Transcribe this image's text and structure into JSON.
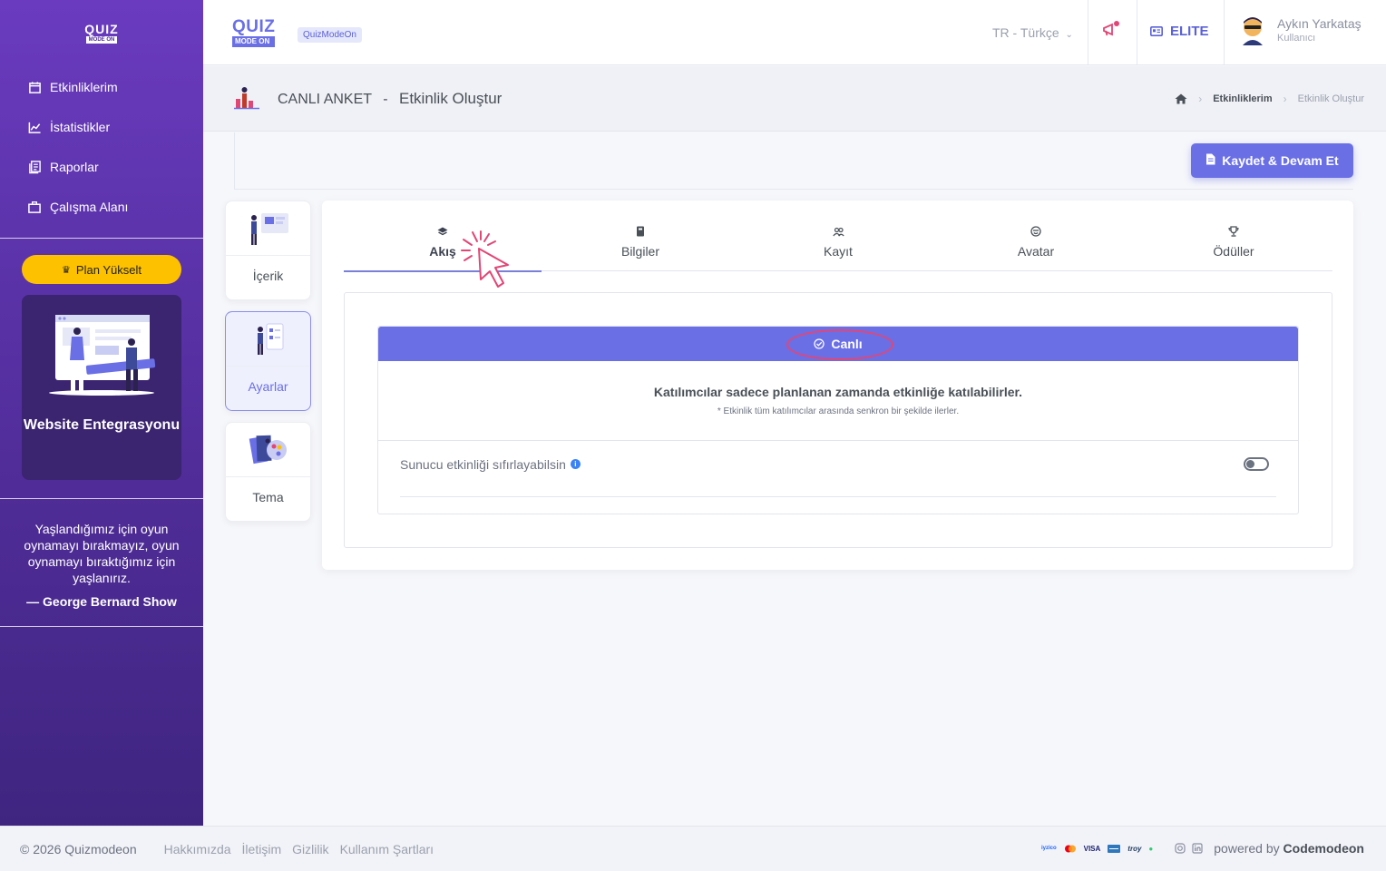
{
  "sidebar": {
    "logo_top": "QUIZ",
    "logo_bottom": "MODE ON",
    "items": [
      {
        "label": "Etkinliklerim",
        "icon": "calendar-icon"
      },
      {
        "label": "İstatistikler",
        "icon": "chart-line-icon"
      },
      {
        "label": "Raporlar",
        "icon": "report-icon"
      },
      {
        "label": "Çalışma Alanı",
        "icon": "briefcase-icon"
      }
    ],
    "plan_label": "Plan Yükselt",
    "promo_title": "Website Entegrasyonu",
    "quote_text": "Yaşlandığımız için oyun oynamayı bırakmayız, oyun oynamayı bıraktığımız için yaşlanırız.",
    "quote_author": "— George Bernard Show"
  },
  "topbar": {
    "logo_top": "QUIZ",
    "logo_bottom": "MODE ON",
    "badge": "QuizModeOn",
    "language": "TR - Türkçe",
    "plan": "ELITE",
    "user_name": "Aykın Yarkataş",
    "user_role": "Kullanıcı"
  },
  "pagehead": {
    "title": "CANLI ANKET",
    "separator": "-",
    "subtitle": "Etkinlik Oluştur",
    "breadcrumb": [
      "Etkinliklerim",
      "Etkinlik Oluştur"
    ]
  },
  "actions": {
    "save_label": "Kaydet & Devam Et"
  },
  "side_tabs": [
    {
      "label": "İçerik",
      "active": false
    },
    {
      "label": "Ayarlar",
      "active": true
    },
    {
      "label": "Tema",
      "active": false
    }
  ],
  "tabs": [
    {
      "label": "Akış",
      "icon": "layers-icon",
      "active": true
    },
    {
      "label": "Bilgiler",
      "icon": "notebook-icon",
      "active": false
    },
    {
      "label": "Kayıt",
      "icon": "users-icon",
      "active": false
    },
    {
      "label": "Avatar",
      "icon": "smile-icon",
      "active": false
    },
    {
      "label": "Ödüller",
      "icon": "trophy-icon",
      "active": false
    }
  ],
  "flow": {
    "mode_label": "Canlı",
    "description": "Katılımcılar sadece planlanan zamanda etkinliğe katılabilirler.",
    "note": "* Etkinlik tüm katılımcılar arasında senkron bir şekilde ilerler.",
    "option_label": "Sunucu etkinliği sıfırlayabilsin",
    "option_enabled": false
  },
  "footer": {
    "copyright": "© 2026 Quizmodeon",
    "links": [
      "Hakkımızda",
      "İletişim",
      "Gizlilik",
      "Kullanım Şartları"
    ],
    "payments": [
      "iyzico",
      "mastercard",
      "VISA",
      "amex",
      "troy"
    ],
    "powered_prefix": "powered by",
    "powered_brand": "Codemodeon"
  },
  "colors": {
    "sidebar_top": "#6a3bbf",
    "sidebar_bottom": "#3f2580",
    "accent": "#6a6fe6",
    "plan_button": "#fdc100",
    "highlight_ring": "#e24675"
  }
}
